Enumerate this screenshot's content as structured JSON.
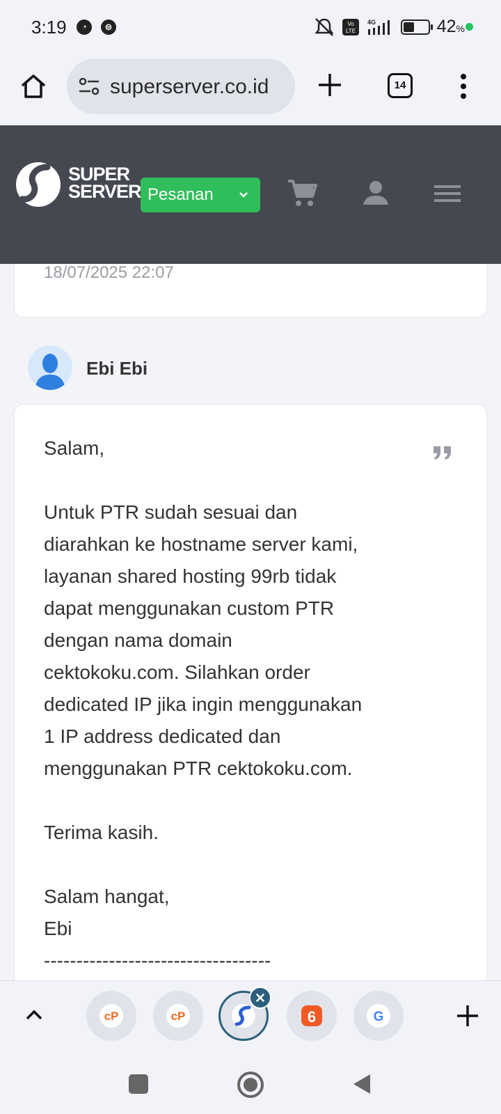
{
  "status_bar": {
    "time": "3:19",
    "battery_percent": "42",
    "percent_sign": "%",
    "network": "4G",
    "volte": "Vo LTE"
  },
  "browser": {
    "url": "superserver.co.id",
    "tab_count": "14"
  },
  "site": {
    "brand_line1": "SUPER",
    "brand_line2": "SERVER",
    "orders_label": "Pesanan",
    "colors": {
      "header_bg": "#464851",
      "accent_green": "#2fbe5a"
    }
  },
  "previous_reply": {
    "timestamp": "18/07/2025 22:07"
  },
  "reply": {
    "author": "Ebi Ebi",
    "lines": [
      "Salam,",
      "",
      "Untuk PTR sudah sesuai dan",
      "diarahkan ke hostname server kami,",
      "layanan shared hosting 99rb tidak",
      "dapat menggunakan custom PTR",
      "dengan nama domain",
      "cektokoku.com. Silahkan order",
      "dedicated IP jika ingin menggunakan",
      "1 IP address dedicated dan",
      "menggunakan PTR cektokoku.com.",
      "",
      "Terima kasih.",
      "",
      "Salam hangat,",
      "Ebi",
      "-----------------------------------"
    ]
  },
  "tab_strip": {
    "tabs": [
      {
        "icon": "cpanel-icon"
      },
      {
        "icon": "cpanel-icon"
      },
      {
        "icon": "superserver-icon",
        "active": true
      },
      {
        "icon": "six-icon"
      },
      {
        "icon": "google-icon"
      }
    ]
  }
}
